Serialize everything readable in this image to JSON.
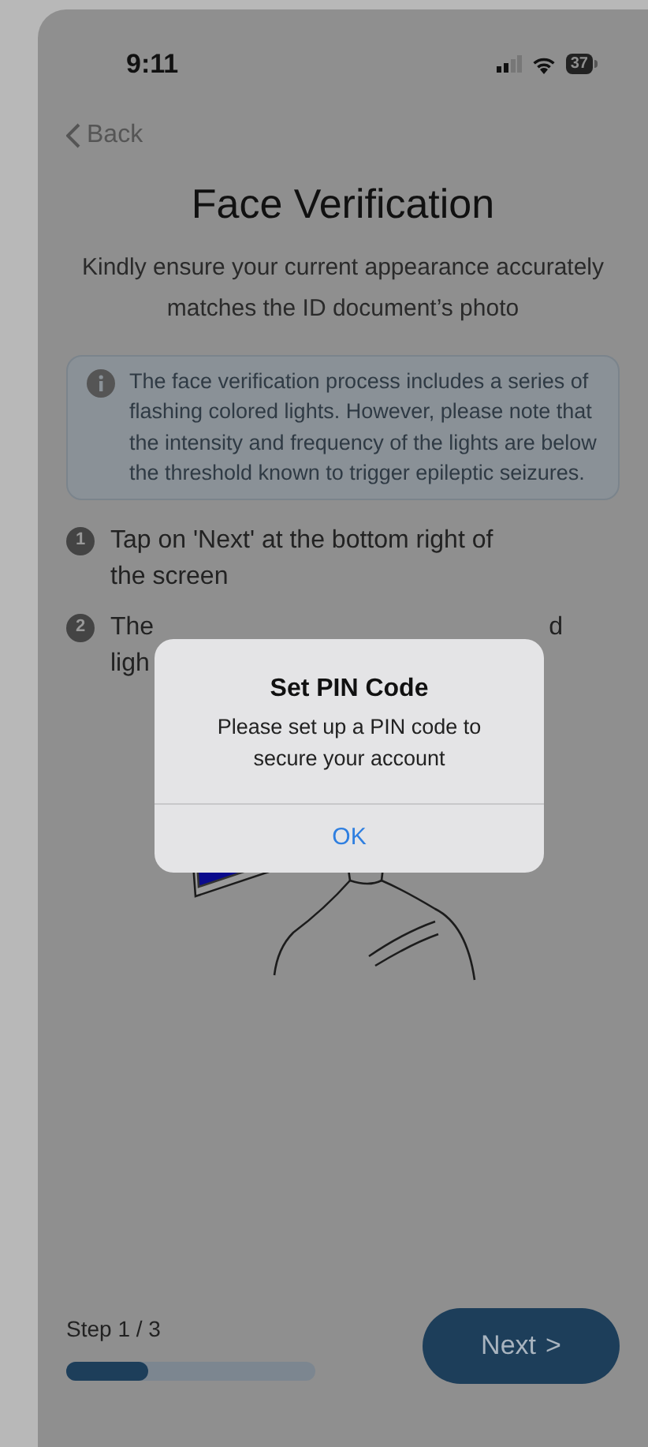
{
  "status_bar": {
    "time": "9:11",
    "battery": "37"
  },
  "back": {
    "label": "Back"
  },
  "title": "Face Verification",
  "subtitle": "Kindly ensure your current appearance accurately matches the ID document’s photo",
  "notice": {
    "text": "The face verification process includes a series of flashing colored lights. However, please note that the intensity and frequency of the lights are below the threshold known to trigger epileptic seizures."
  },
  "steps": [
    {
      "number": "1",
      "lines": [
        "Tap on 'Next' at the bottom right of",
        "the screen"
      ]
    },
    {
      "number": "2",
      "lines": [
        "The",
        "ligh"
      ],
      "line_end": "d"
    }
  ],
  "alert": {
    "title": "Set PIN Code",
    "message": "Please set up a PIN code to secure your account",
    "button": "OK"
  },
  "footer": {
    "step_label": "Step 1 / 3",
    "level": 0.33,
    "next_button": "Next",
    "next_glyph": ">"
  }
}
